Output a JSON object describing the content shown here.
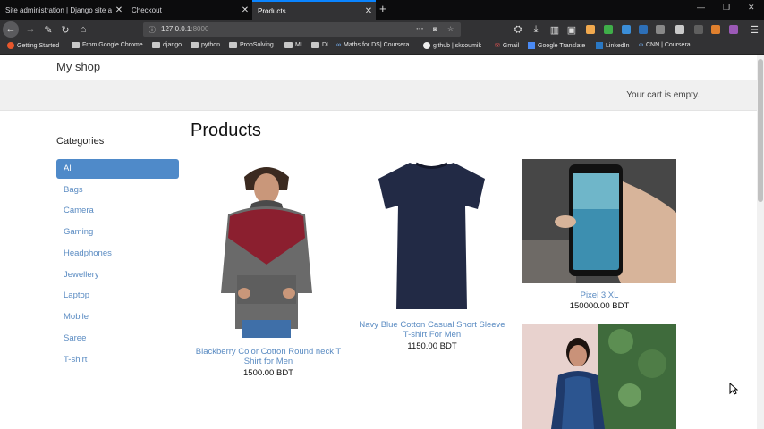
{
  "browser": {
    "tabs": [
      {
        "title": "Site administration | Django site ad",
        "active": false
      },
      {
        "title": "Checkout",
        "active": false
      },
      {
        "title": "Products",
        "active": true
      }
    ],
    "url_host": "127.0.0.1",
    "url_port": ":8000",
    "bookmarks": [
      "Getting Started",
      "From Google Chrome",
      "django",
      "python",
      "ProbSolving",
      "ML",
      "DL",
      "Maths for DS| Coursera",
      "github | sksoumik",
      "Gmail",
      "Google Translate",
      "LinkedIn",
      "CNN | Coursera"
    ]
  },
  "site": {
    "name": "My shop",
    "cart_text": "Your cart is empty."
  },
  "sidebar": {
    "title": "Categories",
    "items": [
      "All",
      "Bags",
      "Camera",
      "Gaming",
      "Headphones",
      "Jewellery",
      "Laptop",
      "Mobile",
      "Saree",
      "T-shirt"
    ],
    "active": "All"
  },
  "main": {
    "title": "Products",
    "products": [
      {
        "name_line1": "Blackberry Color Cotton Round neck T",
        "name_line2": "Shirt for Men",
        "price": "1500.00 BDT"
      },
      {
        "name_line1": "Navy Blue Cotton Casual Short Sleeve",
        "name_line2": "T-shirt For Men",
        "price": "1150.00 BDT"
      },
      {
        "name_line1": "Pixel 3 XL",
        "name_line2": "",
        "price": "150000.00 BDT"
      }
    ]
  },
  "colors": {
    "accent": "#4f8ac9",
    "link": "#5a8bc2",
    "chrome_dark": "#0c0c0d",
    "chrome_mid": "#323234"
  }
}
